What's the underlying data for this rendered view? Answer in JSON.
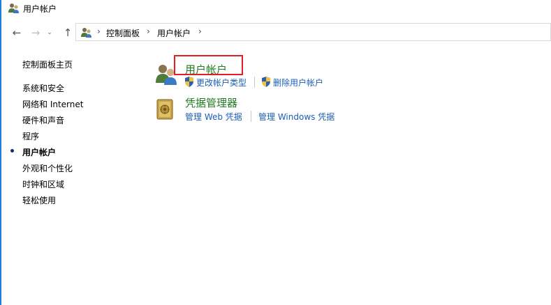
{
  "window": {
    "title": "用户帐户"
  },
  "nav": {
    "back_icon": "←",
    "forward_icon": "→",
    "history_icon": "⌄",
    "up_icon": "↑"
  },
  "address": {
    "separator": "›",
    "crumbs": [
      "控制面板",
      "用户帐户"
    ]
  },
  "sidebar": {
    "home": "控制面板主页",
    "items": [
      {
        "label": "系统和安全"
      },
      {
        "label": "网络和 Internet"
      },
      {
        "label": "硬件和声音"
      },
      {
        "label": "程序"
      },
      {
        "label": "用户帐户",
        "current": true
      },
      {
        "label": "外观和个性化"
      },
      {
        "label": "时钟和区域"
      },
      {
        "label": "轻松使用"
      }
    ]
  },
  "main": {
    "categories": [
      {
        "title": "用户帐户",
        "tasks": [
          "更改帐户类型",
          "删除用户帐户"
        ]
      },
      {
        "title": "凭据管理器",
        "tasks": [
          "管理 Web 凭据",
          "管理 Windows 凭据"
        ]
      }
    ]
  },
  "colors": {
    "link": "#1a5fb4",
    "category_title": "#217a21",
    "highlight": "#e02020",
    "window_border": "#1e7dd8"
  },
  "icons": {
    "title_icon": "users-icon",
    "user_accounts": "users-icon",
    "credential_manager": "vault-icon",
    "uac_shield": "shield-icon"
  }
}
